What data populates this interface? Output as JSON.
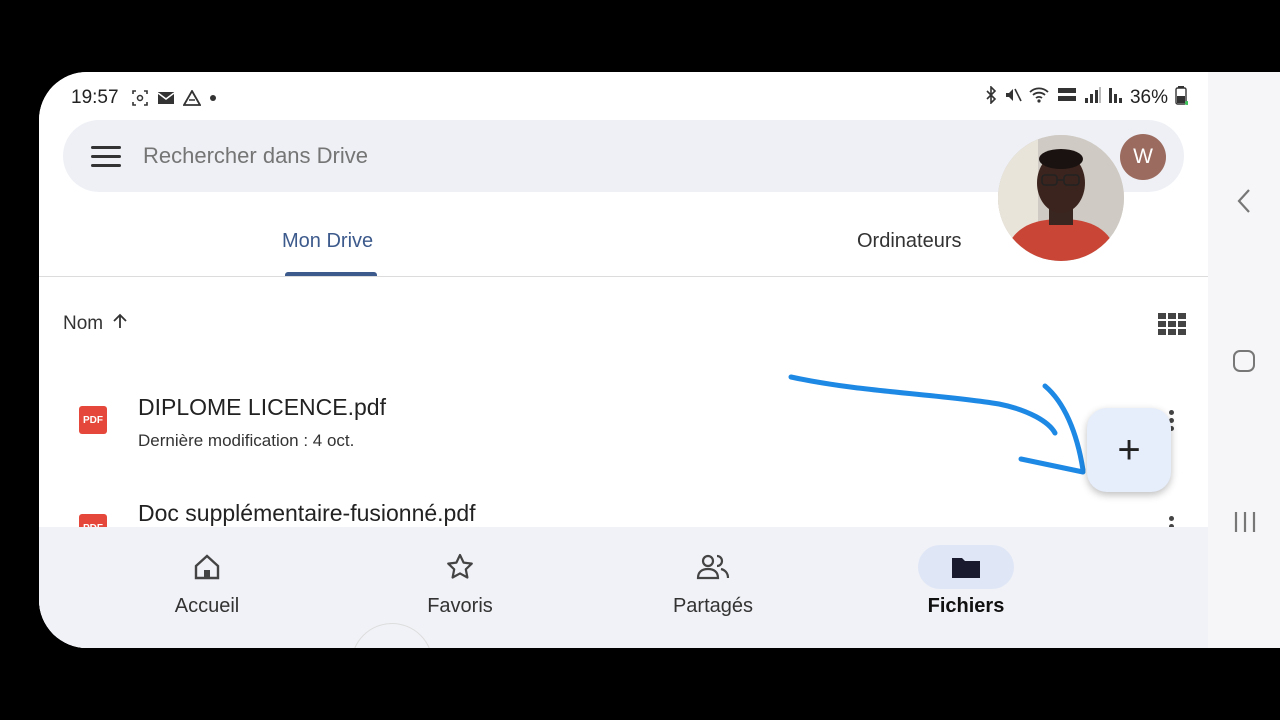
{
  "status": {
    "time": "19:57",
    "battery": "36%"
  },
  "search": {
    "placeholder": "Rechercher dans Drive",
    "avatar_letter": "W"
  },
  "tabs": [
    {
      "label": "Mon Drive"
    },
    {
      "label": "Ordinateurs"
    }
  ],
  "sort": {
    "label": "Nom"
  },
  "files": [
    {
      "name": "DIPLOME LICENCE.pdf",
      "meta": "Dernière modification : 4 oct.",
      "icon": "pdf-icon"
    },
    {
      "name": "Doc supplémentaire-fusionné.pdf",
      "meta": "",
      "icon": "pdf-icon"
    }
  ],
  "pdf_label": "PDF",
  "fab": {
    "label": "+"
  },
  "nav": [
    {
      "label": "Accueil",
      "icon": "home-icon"
    },
    {
      "label": "Favoris",
      "icon": "star-icon"
    },
    {
      "label": "Partagés",
      "icon": "people-icon"
    },
    {
      "label": "Fichiers",
      "icon": "folder-icon",
      "active": true
    }
  ],
  "colors": {
    "accent": "#3d5a8c",
    "annotation": "#1e88e5",
    "pdf": "#e5483a"
  }
}
